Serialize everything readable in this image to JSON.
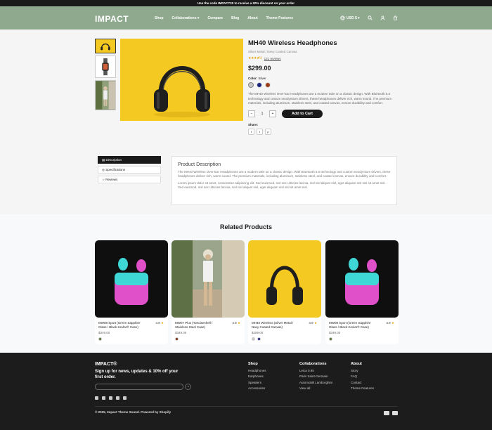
{
  "announcement": "Use the code IMPACT20 to receive a 20% discount on your order",
  "header": {
    "logo": "IMPACT",
    "nav": [
      "Shop",
      "Collaborations ▾",
      "Compare",
      "Blog",
      "About",
      "Theme Features"
    ],
    "currency": "USD $ ▾"
  },
  "product": {
    "title": "MH40 Wireless Headphones",
    "subtitle": "Silver Metal / Navy Coated Canvas",
    "stars": "★★★★½",
    "reviews": "121 reviews",
    "price": "$299.00",
    "color_label": "Color:",
    "color_value": "Silver",
    "swatches": [
      "#c8c8c8",
      "#1a237e",
      "#9a3d1a"
    ],
    "description": "The MH40 Wireless Over-Ear Headphones are a modern take on a classic design. With Bluetooth 5.0 technology and custom neodymium drivers, these headphones deliver rich, warm sound. The premium materials, including aluminum, stainless steel, and coated canvas, ensure durability and comfort.",
    "qty_minus": "−",
    "qty_value": "1",
    "qty_plus": "+",
    "add_to_cart": "Add to Cart",
    "share_label": "Share:",
    "share_icons": [
      "f",
      "t",
      "p"
    ]
  },
  "tabs": {
    "description": "Description",
    "specifications": "Specifications",
    "reviews": "Reviews"
  },
  "desc_panel": {
    "title": "Product Description",
    "p1": "The MH40 Wireless Over-Ear Headphones are a modern take on a classic design. With Bluetooth 5.0 technology and custom neodymium drivers, these headphones deliver rich, warm sound. The premium materials, including aluminum, stainless steel, and coated canvas, ensure durability and comfort.",
    "p2": "Lorem ipsum dolor sit amet, consectetur adipiscing elit. Sed euismod, nisl nec ultricies lacinia, nisl nisl aliquet nisl, eget aliquam nisl nisl sit amet nisl. Sed euismod, nisl nec ultricies lacinia, nisl nisl aliquet nisl, eget aliquam nisl nisl sit amet nisl."
  },
  "related": {
    "title": "Related Products",
    "items": [
      {
        "name": "MW08 Sport (Green Sapphire Glass / Black Kevlar® Case)",
        "price": "$349.00",
        "rating": "4.9",
        "swatches": [
          "#556b2f"
        ]
      },
      {
        "name": "MW07 Plus (Tortoiseshell / Stainless Steel Case)",
        "price": "$349.00",
        "rating": "4.9",
        "swatches": [
          "#7a2a10"
        ]
      },
      {
        "name": "MH40 Wireless (Silver Metal / Navy Coated Canvas)",
        "price": "$299.00",
        "rating": "4.9",
        "swatches": [
          "#c8c8c8",
          "#1a237e"
        ]
      },
      {
        "name": "MW08 Sport (Green Sapphire Glass / Black Kevlar® Case)",
        "price": "$349.00",
        "rating": "4.9",
        "swatches": [
          "#556b2f"
        ]
      }
    ]
  },
  "footer": {
    "logo": "IMPACT®",
    "signup": "Sign up for news, updates & 10% off your first order.",
    "cols": [
      {
        "title": "Shop",
        "links": [
          "Headphones",
          "Earphones",
          "Speakers",
          "Accessories"
        ]
      },
      {
        "title": "Collaborations",
        "links": [
          "Leica 0.95",
          "Paris Saint-Germain",
          "Automobili Lamborghini",
          "View all"
        ]
      },
      {
        "title": "About",
        "links": [
          "Story",
          "FAQ",
          "Contact",
          "Theme Features"
        ]
      }
    ],
    "copyright": "© 2025, Impact Theme Sound. Powered by Shopify"
  }
}
